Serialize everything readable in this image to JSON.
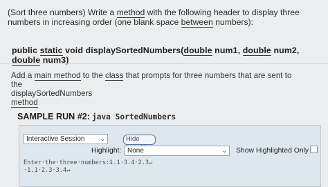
{
  "problem": {
    "intro_before": "(Sort three numbers) Write a ",
    "intro_method": "method",
    "intro_mid": " with the following header to display three numbers in increasing order (one blank space ",
    "intro_between": "between",
    "intro_end": " numbers):",
    "header": {
      "public": "public ",
      "static": "static",
      "void_name": " void displaySortedNumbers(",
      "double1": "double",
      "num1": " num1, ",
      "double2": "double",
      "num2": " num2, ",
      "double3": "double",
      "num3": " num3)"
    },
    "task": {
      "t1": "Add a ",
      "main_method": "main method",
      "t2": " to the ",
      "class": "class",
      "t3": " that prompts for three numbers that are sent to the",
      "line2": "displaySortedNumbers",
      "line3": "method"
    }
  },
  "sample_run": {
    "label": "SAMPLE RUN #2:",
    "command": "java SortedNumbers"
  },
  "session": {
    "mode_value": "Interactive Session",
    "hide_invisibles_label": "Hide Invisibles",
    "highlight_label": "Highlight:",
    "highlight_value": "None",
    "show_highlighted_label": "Show Highlighted Only",
    "console_line1": "Enter·the·three·numbers:1.1·3.4·2.3↵",
    "console_line2": "·1.1·2.3·3.4↵"
  }
}
